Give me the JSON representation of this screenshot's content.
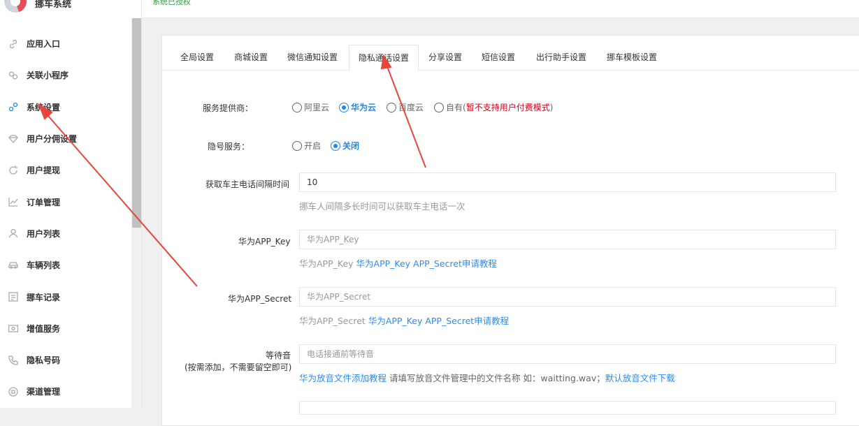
{
  "brand": {
    "name": "挪车系统"
  },
  "topbar": {
    "status": "系统已授权"
  },
  "sidebar": {
    "items": [
      {
        "label": "应用入口",
        "icon": "link-icon"
      },
      {
        "label": "关联小程序",
        "icon": "mini-program-icon"
      },
      {
        "label": "系统设置",
        "icon": "gears-icon"
      },
      {
        "label": "用户分佣设置",
        "icon": "diamond-icon"
      },
      {
        "label": "用户提现",
        "icon": "refresh-icon"
      },
      {
        "label": "订单管理",
        "icon": "chart-icon"
      },
      {
        "label": "用户列表",
        "icon": "user-icon"
      },
      {
        "label": "车辆列表",
        "icon": "car-icon"
      },
      {
        "label": "挪车记录",
        "icon": "list-icon"
      },
      {
        "label": "增值服务",
        "icon": "wallet-icon"
      },
      {
        "label": "隐私号码",
        "icon": "phone-icon"
      },
      {
        "label": "渠道管理",
        "icon": "channel-icon"
      }
    ]
  },
  "tabs": [
    {
      "label": "全局设置"
    },
    {
      "label": "商城设置"
    },
    {
      "label": "微信通知设置"
    },
    {
      "label": "隐私通话设置",
      "active": true
    },
    {
      "label": "分享设置"
    },
    {
      "label": "短信设置"
    },
    {
      "label": "出行助手设置"
    },
    {
      "label": "挪车模板设置"
    }
  ],
  "form": {
    "provider": {
      "label": "服务提供商：",
      "options": [
        "阿里云",
        "华为云",
        "百度云",
        "自有("
      ],
      "selected": "华为云",
      "warning": "暂不支持用户付费模式",
      "close_paren": ")"
    },
    "hidden_number": {
      "label": "隐号服务：",
      "options": [
        "开启",
        "关闭"
      ],
      "selected": "关闭"
    },
    "interval": {
      "label": "获取车主电话间隔时间",
      "value": "10",
      "hint": "挪车人间隔多长时间可以获取车主电话一次"
    },
    "app_key": {
      "label": "华为APP_Key",
      "placeholder": "华为APP_Key",
      "hint_prefix": "华为APP_Key",
      "hint_link": "华为APP_Key APP_Secret申请教程"
    },
    "app_secret": {
      "label": "华为APP_Secret",
      "placeholder": "华为APP_Secret",
      "hint_prefix": "华为APP_Secret",
      "hint_link": "华为APP_Key APP_Secret申请教程"
    },
    "waiting_tone": {
      "label": "等待音",
      "sublabel": "(按需添加，不需要留空即可)",
      "placeholder": "电话接通前等待音",
      "hint_link1": "华为放音文件添加教程",
      "hint_text": "请填写放音文件管理中的文件名称 如：waitting.wav；",
      "hint_link2": "默认放音文件下载"
    }
  },
  "colors": {
    "accent": "#1e88e5",
    "link": "#2d8cf0",
    "warning": "#d0021b",
    "arrow": "#e8453c"
  }
}
